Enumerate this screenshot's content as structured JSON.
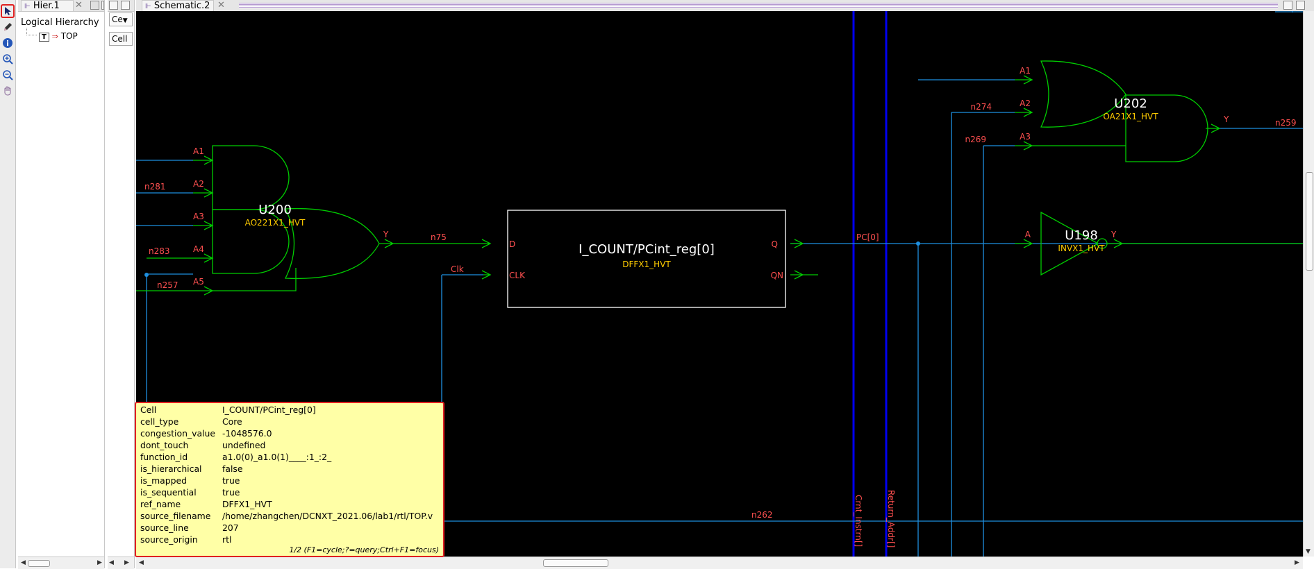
{
  "toolbar": {
    "tools": [
      {
        "name": "select-arrow-icon"
      },
      {
        "name": "pencil-icon"
      },
      {
        "name": "info-icon"
      },
      {
        "name": "zoom-in-icon"
      },
      {
        "name": "zoom-out-icon"
      },
      {
        "name": "pan-hand-icon"
      }
    ]
  },
  "hier_panel": {
    "tab_label": "Hier.1",
    "title": "Logical Hierarchy",
    "tree_badge": "T",
    "tree_item": "TOP"
  },
  "mid_panel": {
    "dropdown_label": "Ce",
    "field_label": "Cell"
  },
  "schematic": {
    "tab_label": "Schematic.2",
    "colors": {
      "wire": "#1e90ff",
      "gate": "#00d000",
      "pin": "#ff5050",
      "cell_type": "#ffcc00",
      "bus": "#0000ff",
      "label": "#ffffff"
    },
    "cells": [
      {
        "name": "U200",
        "type": "AO221X1_HVT"
      },
      {
        "name": "I_COUNT/PCint_reg[0]",
        "type": "DFFX1_HVT"
      },
      {
        "name": "U202",
        "type": "OA21X1_HVT"
      },
      {
        "name": "U198",
        "type": "INVX1_HVT"
      }
    ],
    "pins": {
      "u200": [
        "A1",
        "A2",
        "A3",
        "A4",
        "A5",
        "Y"
      ],
      "dff": [
        "D",
        "CLK",
        "Q",
        "QN"
      ],
      "u202": [
        "A1",
        "A2",
        "A3",
        "Y"
      ],
      "u198": [
        "A",
        "Y"
      ]
    },
    "nets": [
      "n281",
      "n283",
      "n257",
      "n75",
      "Clk",
      "PC[0]",
      "n274",
      "n269",
      "n259",
      "n262",
      "Crnt_Instrn[]",
      "Return_Addr[]"
    ]
  },
  "properties": {
    "rows": [
      {
        "key": "Cell",
        "value": "I_COUNT/PCint_reg[0]"
      },
      {
        "key": "cell_type",
        "value": "Core"
      },
      {
        "key": "congestion_value",
        "value": "-1048576.0"
      },
      {
        "key": "dont_touch",
        "value": "undefined"
      },
      {
        "key": "function_id",
        "value": "a1.0(0)_a1.0(1)____:1_:2_"
      },
      {
        "key": "is_hierarchical",
        "value": "false"
      },
      {
        "key": "is_mapped",
        "value": "true"
      },
      {
        "key": "is_sequential",
        "value": "true"
      },
      {
        "key": "ref_name",
        "value": "DFFX1_HVT"
      },
      {
        "key": "source_filename",
        "value": "/home/zhangchen/DCNXT_2021.06/lab1/rtl/TOP.v"
      },
      {
        "key": "source_line",
        "value": "207"
      },
      {
        "key": "source_origin",
        "value": "rtl"
      }
    ],
    "footer": "1/2 (F1=cycle;?=query;Ctrl+F1=focus)"
  }
}
